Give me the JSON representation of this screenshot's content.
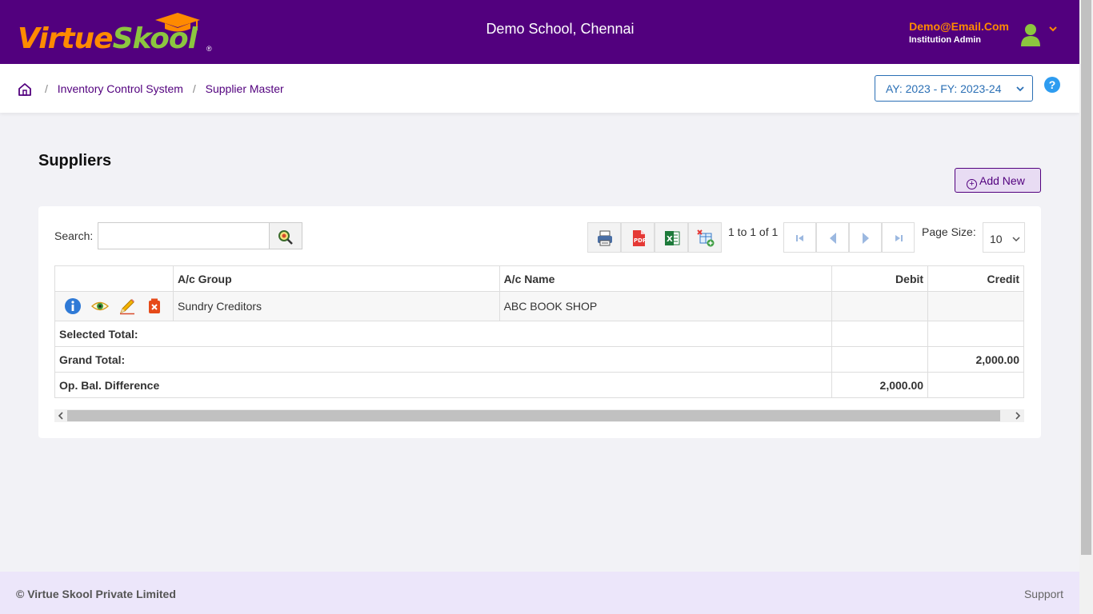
{
  "header": {
    "logo_part1": "Virtue",
    "logo_part2": "Skool",
    "logo_reg": "®",
    "school_name": "Demo School, Chennai",
    "user_email": "Demo@Email.Com",
    "user_role": "Institution Admin",
    "bg_color": "#52007e",
    "email_color": "#ff8a00"
  },
  "breadcrumb": {
    "items": [
      "Inventory Control System",
      "Supplier Master"
    ],
    "separator": "/",
    "academic_year": "AY: 2023 - FY: 2023-24"
  },
  "help": {
    "label": "?"
  },
  "main": {
    "title": "Suppliers",
    "add_new_label": "Add New"
  },
  "toolbar": {
    "search_label": "Search:",
    "search_value": "",
    "range_text": "1 to 1 of 1",
    "page_size_label": "Page Size:",
    "page_size_value": "10"
  },
  "grid": {
    "columns": [
      "",
      "A/c Group",
      "A/c Name",
      "Debit",
      "Credit"
    ],
    "rows": [
      {
        "group": "Sundry Creditors",
        "name": "ABC BOOK SHOP",
        "debit": "",
        "credit": ""
      }
    ],
    "selected_total": {
      "label": "Selected Total:",
      "debit": "",
      "credit": ""
    },
    "grand_total": {
      "label": "Grand Total:",
      "debit": "",
      "credit": "2,000.00"
    },
    "op_bal_diff": {
      "label": "Op. Bal. Difference",
      "debit": "2,000.00",
      "credit": ""
    }
  },
  "footer": {
    "copyright": "© Virtue Skool Private Limited",
    "support": "Support"
  }
}
